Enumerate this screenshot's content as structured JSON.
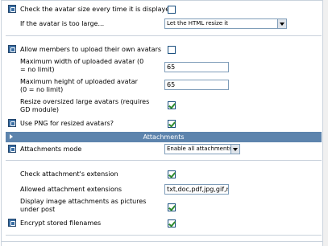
{
  "avatar": {
    "check_size_label": "Check the avatar size every time it is displayed",
    "check_size_checked": false,
    "too_large_label": "If the avatar is too large...",
    "too_large_selected": "Let the HTML resize it",
    "allow_upload_label": "Allow members to upload their own avatars",
    "allow_upload_checked": false,
    "max_width_label": "Maximum width of uploaded avatar (0 = no limit)",
    "max_width_value": "65",
    "max_height_label": "Maximum height of uploaded avatar (0 = no limit)",
    "max_height_value": "65",
    "resize_label": "Resize oversized large avatars (requires GD module)",
    "resize_checked": true,
    "png_label": "Use PNG for resized avatars?",
    "png_checked": true
  },
  "attachments_section": {
    "title": "Attachments",
    "mode_label": "Attachments mode",
    "mode_selected": "Enable all attachments",
    "check_ext_label": "Check attachment's extension",
    "check_ext_checked": true,
    "allowed_ext_label": "Allowed attachment extensions",
    "allowed_ext_value": "txt,doc,pdf,jpg,gif,mp",
    "display_images_label": "Display image attachments as pictures under post",
    "display_images_checked": true,
    "encrypt_label": "Encrypt stored filenames",
    "encrypt_checked": true
  },
  "colors": {
    "section_header_bg": "#5d84ad",
    "bulb_icon": "#3b6fa4",
    "check_mark": "#2e8b2e",
    "border": "#c9d2dc"
  }
}
